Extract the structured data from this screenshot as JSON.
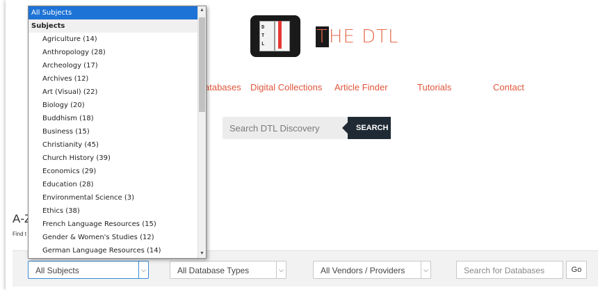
{
  "header": {
    "logo_letters": "D\nT\nL",
    "logo_text_first": "T",
    "logo_text_rest": "HE DTL"
  },
  "nav": {
    "items": [
      {
        "label": "atabases"
      },
      {
        "label": "Digital Collections"
      },
      {
        "label": "Article Finder"
      },
      {
        "label": "Tutorials"
      },
      {
        "label": "Contact"
      }
    ]
  },
  "search": {
    "placeholder": "Search DTL Discovery",
    "button": "SEARCH"
  },
  "az": {
    "title": "A-Z",
    "subtitle": "Find t"
  },
  "filters": {
    "subjects": "All Subjects",
    "types": "All Database Types",
    "vendors": "All Vendors / Providers",
    "db_search_placeholder": "Search for Databases",
    "go": "Go"
  },
  "dropdown": {
    "selected": "All Subjects",
    "group": "Subjects",
    "options": [
      "Agriculture (14)",
      "Anthropology (28)",
      "Archeology (17)",
      "Archives (12)",
      "Art (Visual) (22)",
      "Biology (20)",
      "Buddhism (18)",
      "Business (15)",
      "Christianity (45)",
      "Church History (39)",
      "Economics (29)",
      "Education (28)",
      "Environmental Science (3)",
      "Ethics (38)",
      "French Language Resources (15)",
      "Gender & Women's Studies (12)",
      "German Language Resources (14)"
    ]
  },
  "colors": {
    "accent": "#e0553a",
    "selected": "#1e73d6",
    "dark": "#1f2a34"
  }
}
